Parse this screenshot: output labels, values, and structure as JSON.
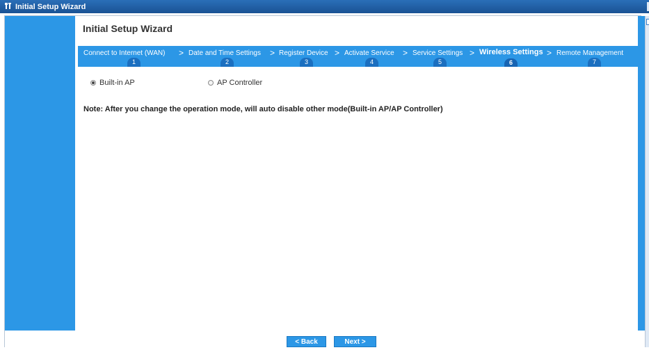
{
  "window": {
    "title": "Initial Setup Wizard",
    "icon": "wrench-icon"
  },
  "wizard": {
    "title": "Initial Setup Wizard"
  },
  "steps": [
    {
      "label": "Connect to Internet (WAN)",
      "number": "1"
    },
    {
      "label": "Date and Time Settings",
      "number": "2"
    },
    {
      "label": "Register Device",
      "number": "3"
    },
    {
      "label": "Activate Service",
      "number": "4"
    },
    {
      "label": "Service Settings",
      "number": "5"
    },
    {
      "label": "Wireless Settings",
      "number": "6"
    },
    {
      "label": "Remote Management",
      "number": "7"
    }
  ],
  "active_step": 6,
  "step_separator": ">",
  "mode": {
    "options": [
      {
        "label": "Built-in AP",
        "checked": true
      },
      {
        "label": "AP Controller",
        "checked": false
      }
    ]
  },
  "note": "Note: After you change the operation mode, will auto disable other mode(Built-in AP/AP Controller)",
  "buttons": {
    "back": "< Back",
    "next": "Next >"
  },
  "colors": {
    "accent": "#2c97e6",
    "titlebar": "#1f5fa6"
  }
}
